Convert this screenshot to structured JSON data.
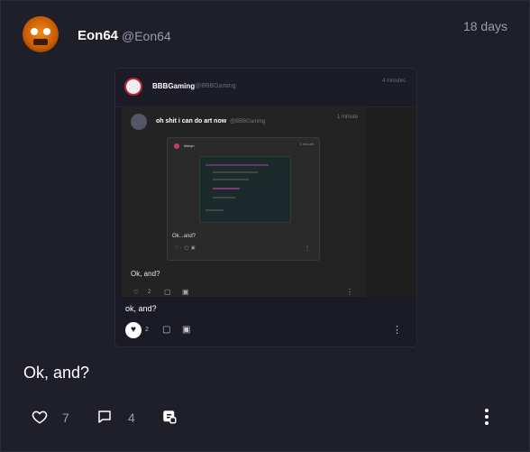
{
  "post": {
    "author_name": "Eon64",
    "author_handle": "@Eon64",
    "time": "18 days",
    "text": "Ok, and?",
    "stats": {
      "likes": "7",
      "replies": "4"
    }
  },
  "embed": {
    "author_name": "BBBGaming",
    "author_handle": "@BBBGaming",
    "time": "4 minutes",
    "text": "ok, and?",
    "likes": "2",
    "inner": {
      "author_name": "oh shit i can do art now",
      "author_handle": "@BBBGaming",
      "time": "1 minute",
      "text": "Ok, and?",
      "likes": "2",
      "nested": {
        "author_name": "hiimyn",
        "time": "1 minute",
        "text": "Ok...and?"
      }
    }
  },
  "icons": {
    "like": "heart-icon",
    "reply": "comment-icon",
    "reshare": "reshare-icon",
    "more": "more-vertical-icon"
  },
  "colors": {
    "background": "#1f1f2a",
    "text": "#ffffff",
    "muted": "#9a9aac"
  }
}
